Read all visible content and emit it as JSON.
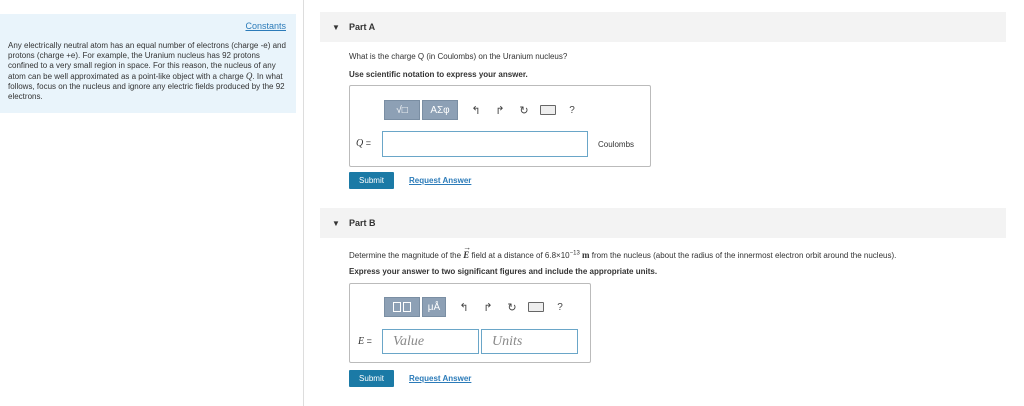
{
  "sidebar": {
    "constants_label": "Constants",
    "intro_1": "Any electrically neutral atom has an equal number of electrons (charge -e) and protons (charge +e). For example, the Uranium nucleus has 92 protons confined to a very small region in space. For this reason, the nucleus of any atom can be well approximated as a point-like object with a charge ",
    "intro_q": "Q",
    "intro_2": ". In what follows, focus on the nucleus and ignore any electric fields produced by the 92 electrons."
  },
  "part_a": {
    "title": "Part A",
    "question": "What is the charge Q (in Coulombs) on the Uranium nucleus?",
    "instruction": "Use scientific notation to express your answer.",
    "toolbar": {
      "templates": "√□",
      "greek": "ΑΣφ",
      "help": "?"
    },
    "var_label": "Q",
    "eq": "=",
    "value": "",
    "unit": "Coulombs",
    "submit": "Submit",
    "request": "Request Answer"
  },
  "part_b": {
    "title": "Part B",
    "question_1": "Determine the magnitude of the ",
    "question_E": "E",
    "question_2": " field at a distance of 6.8×10",
    "question_exp": "−13",
    "question_m": "m",
    "question_3": " from the nucleus (about the radius of the innermost electron orbit around the nucleus).",
    "instruction": "Express your answer to two significant figures and include the appropriate units.",
    "toolbar": {
      "units": "μÅ",
      "help": "?"
    },
    "var_label": "E",
    "eq": "=",
    "value_placeholder": "Value",
    "units_placeholder": "Units",
    "submit": "Submit",
    "request": "Request Answer"
  },
  "icons": [
    "collapse-triangle-icon",
    "templates-icon",
    "greek-icon",
    "undo-icon",
    "redo-icon",
    "reset-icon",
    "keyboard-icon",
    "help-icon",
    "units-icon"
  ]
}
